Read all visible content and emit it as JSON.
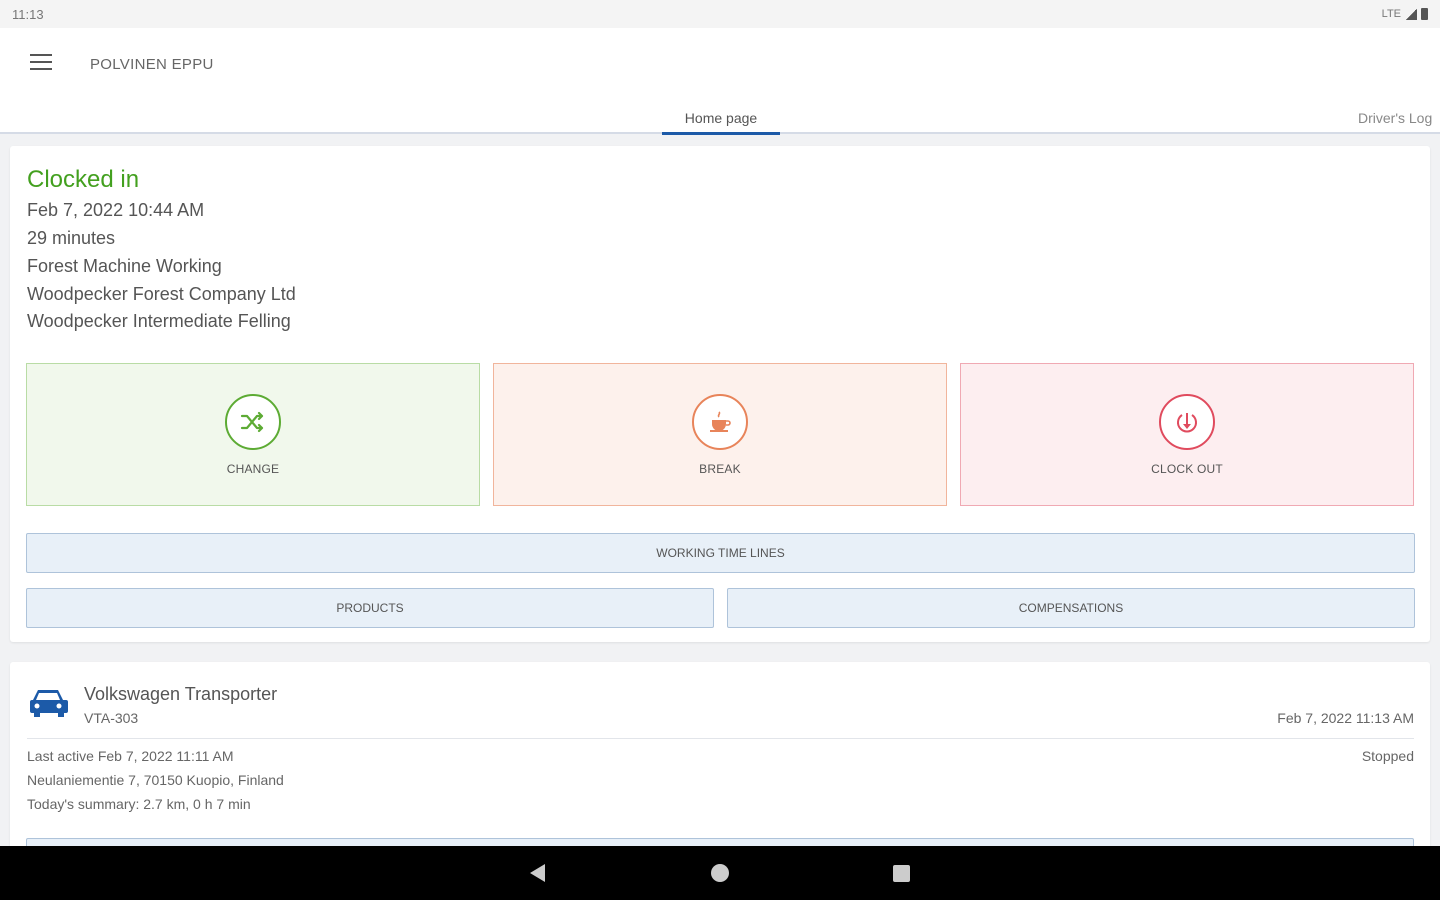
{
  "statusbar": {
    "time": "11:13",
    "network": "LTE"
  },
  "appbar": {
    "title": "POLVINEN EPPU",
    "tabs": [
      {
        "label": "Home page",
        "active": true
      },
      {
        "label": "Driver's Log",
        "active": false
      }
    ]
  },
  "clock": {
    "status": "Clocked in",
    "status_color": "#43a01f",
    "since": "Feb 7, 2022 10:44 AM",
    "duration": "29 minutes",
    "activity": "Forest Machine Working",
    "company": "Woodpecker Forest Company Ltd",
    "site": "Woodpecker Intermediate Felling"
  },
  "actions": [
    {
      "label": "CHANGE",
      "icon": "shuffle-icon",
      "color": "#5dab34"
    },
    {
      "label": "BREAK",
      "icon": "coffee-cup-icon",
      "color": "#e8845a"
    },
    {
      "label": "CLOCK OUT",
      "icon": "clock-out-icon",
      "color": "#e04b5e"
    }
  ],
  "buttons": {
    "working_time_lines": "WORKING TIME LINES",
    "products": "PRODUCTS",
    "compensations": "COMPENSATIONS"
  },
  "vehicle": {
    "name": "Volkswagen Transporter",
    "plate": "VTA-303",
    "timestamp": "Feb 7, 2022 11:13 AM",
    "last_active": "Last active Feb 7, 2022 11:11 AM",
    "address": "Neulaniementie 7, 70150 Kuopio, Finland",
    "summary": "Today's summary: 2.7 km, 0 h 7 min",
    "state": "Stopped",
    "icon": "car-icon",
    "icon_color": "#1c5aa8"
  }
}
